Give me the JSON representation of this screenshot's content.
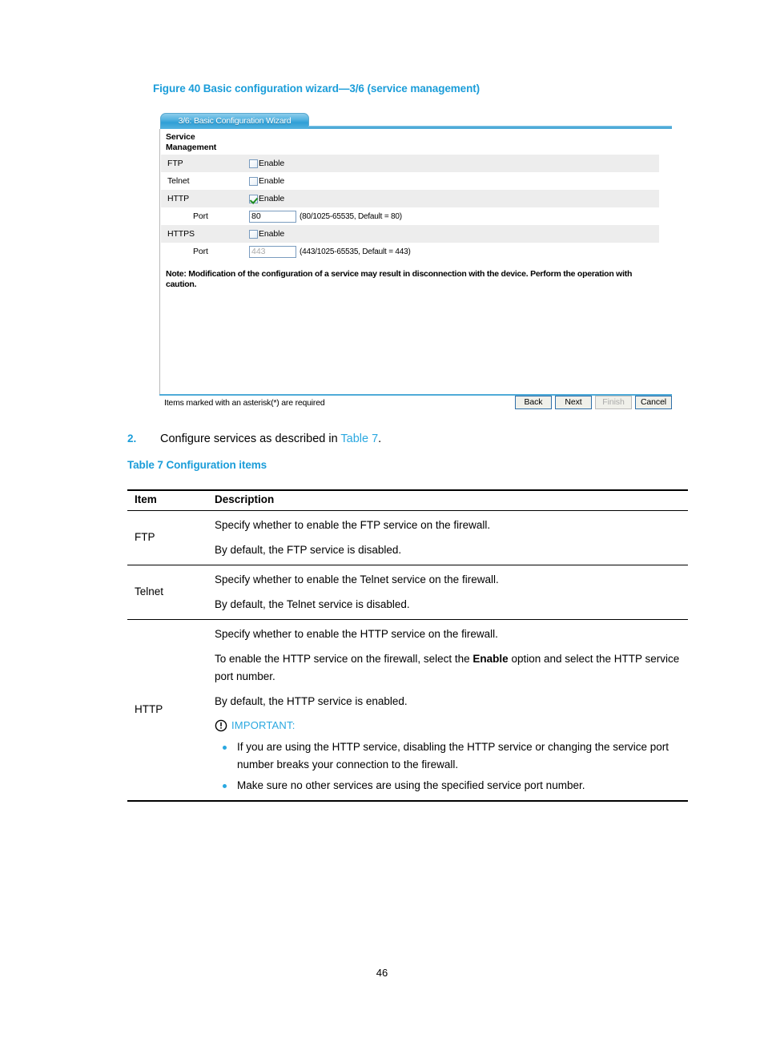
{
  "figure": {
    "caption": "Figure 40 Basic configuration wizard—3/6 (service management)"
  },
  "wizard": {
    "tab_label": "3/6: Basic Configuration Wizard",
    "section_title": "Service\nManagement",
    "rows": [
      {
        "label": "FTP",
        "control": "checkbox",
        "checkbox_label": "Enable",
        "checked": false
      },
      {
        "label": "Telnet",
        "control": "checkbox",
        "checkbox_label": "Enable",
        "checked": false
      },
      {
        "label": "HTTP",
        "control": "checkbox",
        "checkbox_label": "Enable",
        "checked": true
      },
      {
        "label": "Port",
        "control": "text",
        "value": "80",
        "hint": "(80/1025-65535, Default = 80)",
        "disabled": false
      },
      {
        "label": "HTTPS",
        "control": "checkbox",
        "checkbox_label": "Enable",
        "checked": false
      },
      {
        "label": "Port",
        "control": "text",
        "value": "443",
        "hint": "(443/1025-65535, Default = 443)",
        "disabled": true
      }
    ],
    "note": "Note: Modification of the configuration of a service may result in disconnection with the device. Perform the operation with caution.",
    "footer_note": "Items marked with an asterisk(*) are required",
    "buttons": [
      {
        "label": "Back",
        "disabled": false
      },
      {
        "label": "Next",
        "disabled": false
      },
      {
        "label": "Finish",
        "disabled": true
      },
      {
        "label": "Cancel",
        "disabled": false
      }
    ]
  },
  "step": {
    "number": "2.",
    "text_before": "Configure services as described in ",
    "xref": "Table 7",
    "text_after": "."
  },
  "table": {
    "caption": "Table 7 Configuration items",
    "headers": {
      "item": "Item",
      "description": "Description"
    },
    "rows": [
      {
        "item": "FTP",
        "paragraphs": [
          "Specify whether to enable the FTP service on the firewall.",
          "By default, the FTP service is disabled."
        ]
      },
      {
        "item": "Telnet",
        "paragraphs": [
          "Specify whether to enable the Telnet service on the firewall.",
          "By default, the Telnet service is disabled."
        ]
      },
      {
        "item": "HTTP",
        "paragraphs": [
          "Specify whether to enable the HTTP service on the firewall."
        ],
        "rich_paragraph": {
          "before": "To enable the HTTP service on the firewall, select the ",
          "bold": "Enable",
          "after": " option and select the HTTP service port number."
        },
        "paragraphs_after": [
          "By default, the HTTP service is enabled."
        ],
        "important_label": "IMPORTANT:",
        "bullets": [
          "If you are using the HTTP service, disabling the HTTP service or changing the service port number breaks your connection to the firewall.",
          "Make sure no other services are using the specified service port number."
        ]
      }
    ]
  },
  "page": {
    "number": "46"
  },
  "colors": {
    "accent_blue": "#1b9dd9",
    "link_blue": "#2aa8e0",
    "tab_blue": "#2f9fd6",
    "row_shade": "#ededed",
    "check_green": "#1f8c1f"
  }
}
